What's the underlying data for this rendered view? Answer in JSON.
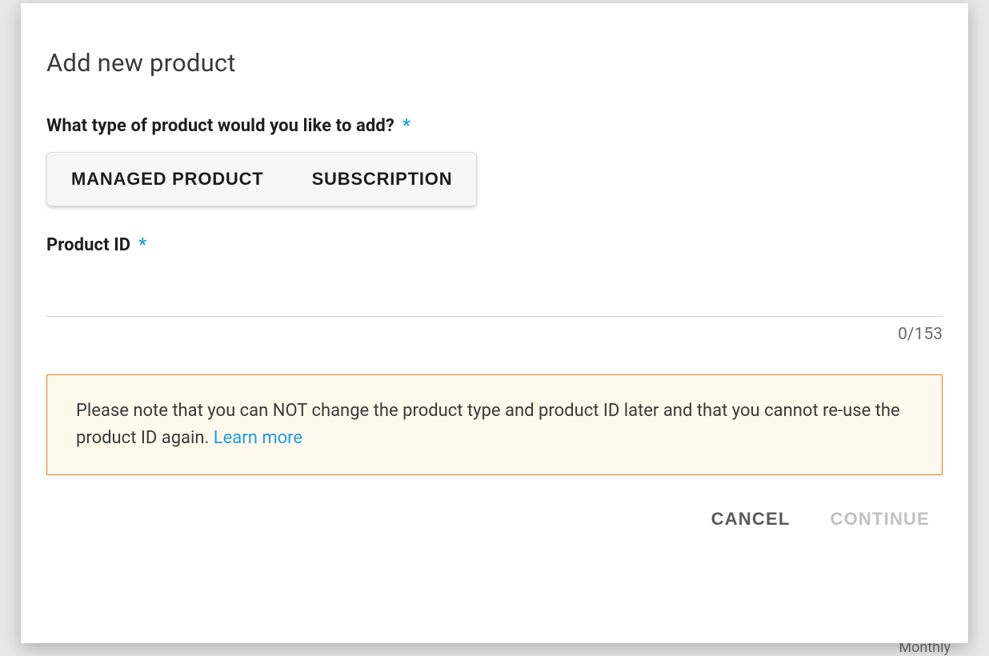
{
  "dialog": {
    "title": "Add new product",
    "type": {
      "question": "What type of product would you like to add?",
      "options": [
        "MANAGED PRODUCT",
        "SUBSCRIPTION"
      ]
    },
    "productId": {
      "label": "Product ID",
      "value": "",
      "counter": "0/153"
    },
    "notice": {
      "text": "Please note that you can NOT change the product type and product ID later and that you cannot re-use the product ID again. ",
      "linkText": "Learn more"
    },
    "actions": {
      "cancel": "CANCEL",
      "continue": "CONTINUE"
    }
  },
  "background": {
    "hint": "Monthly"
  }
}
